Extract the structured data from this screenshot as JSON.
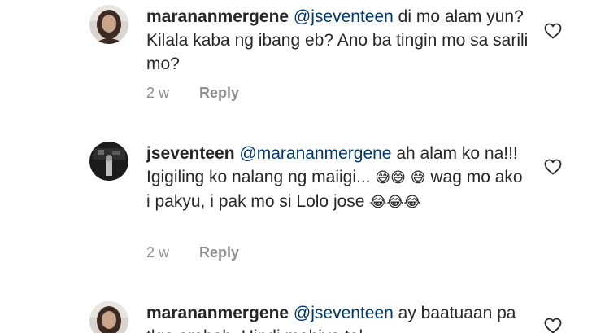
{
  "comments": [
    {
      "username": "marananmergene",
      "mention": "@jseventeen",
      "body": "di mo alam yun? Kilala kaba ng ibang eb? Ano ba tingin mo sa sarili mo?",
      "time": "2 w",
      "reply_label": "Reply",
      "avatar_icon": "profile-photo-woman"
    },
    {
      "username": "jseventeen",
      "mention": "@marananmergene",
      "body_1": "ah alam ko na!!! Igigiling ko nalang ng maiigi...",
      "emoji_1": "😅😅",
      "emoji_2": "😅",
      "body_2": "wag mo ako i pakyu, i pak mo si Lolo jose",
      "emoji_3": "😂😂😂",
      "time": "2 w",
      "reply_label": "Reply",
      "avatar_icon": "profile-photo-dark"
    },
    {
      "username": "marananmergene",
      "mention": "@jseventeen",
      "body": "ay baatuaan pa tlga arabab. Hindi mahiya tal",
      "avatar_icon": "profile-photo-woman"
    }
  ],
  "icons": {
    "like": "heart-outline-icon"
  },
  "colors": {
    "text": "#262626",
    "mention": "#00376b",
    "meta": "#8e8e8e"
  }
}
